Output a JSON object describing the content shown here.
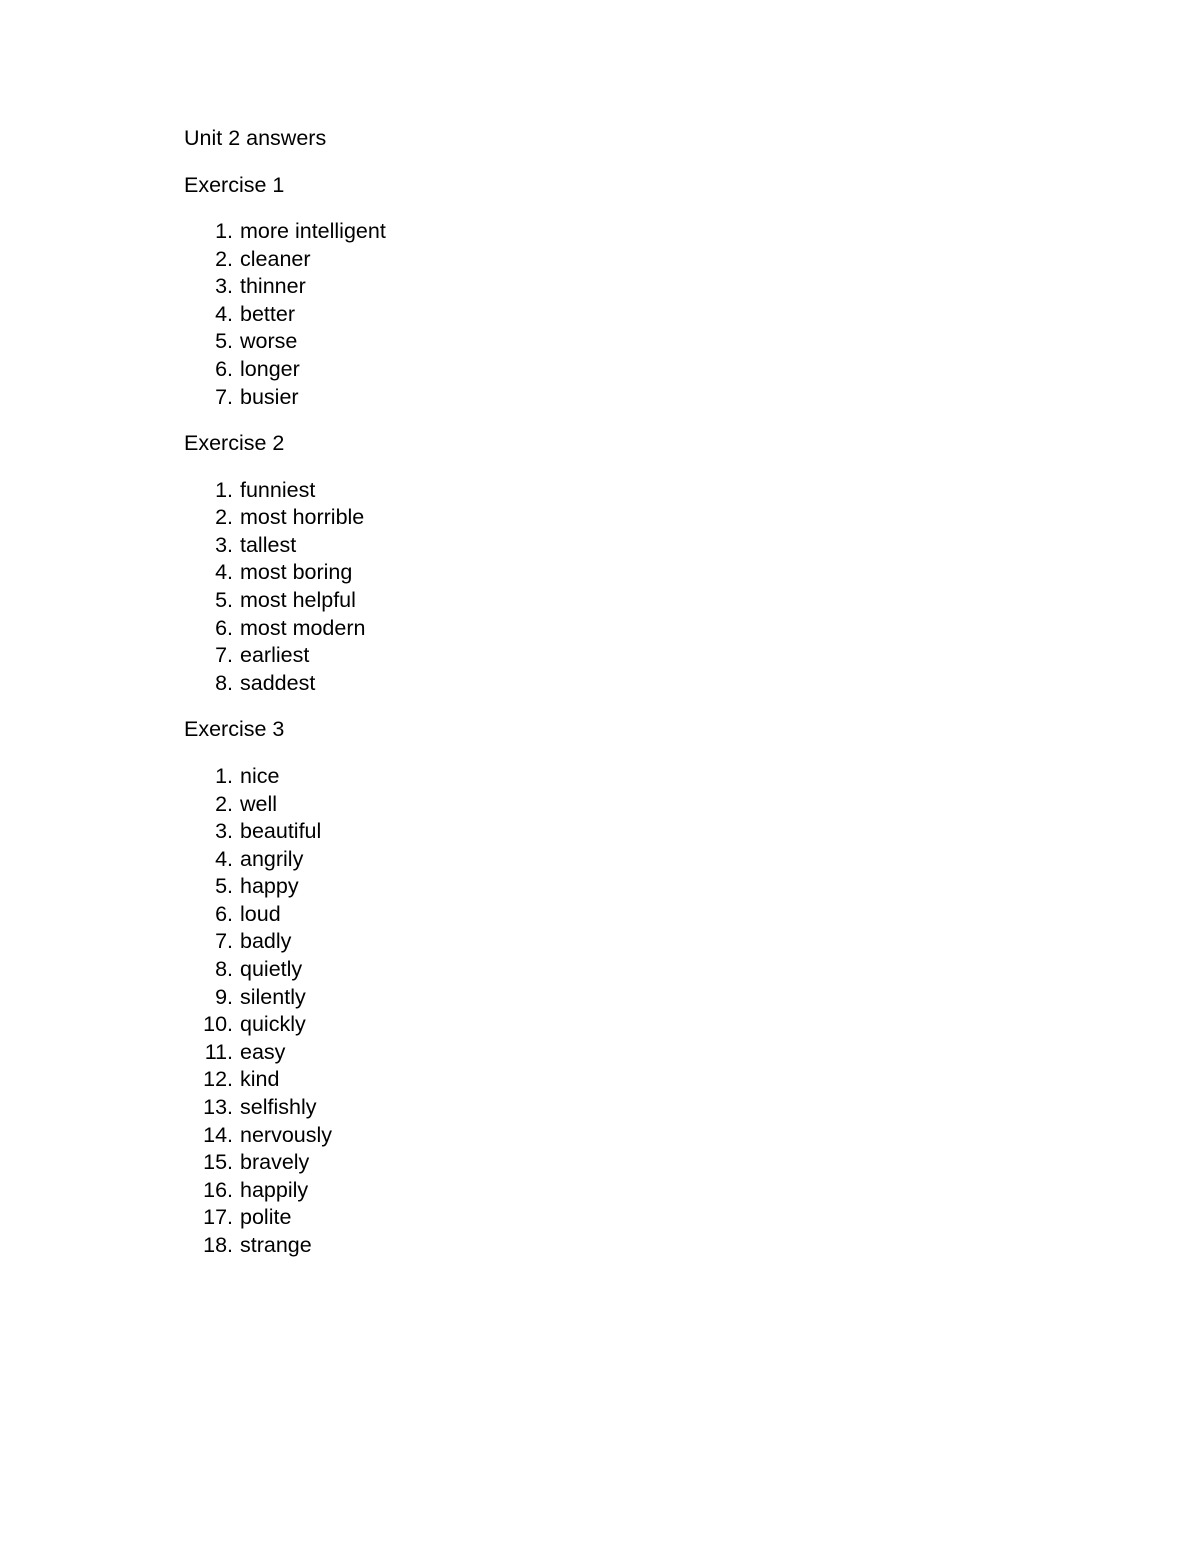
{
  "document": {
    "title": "Unit 2 answers",
    "background_color": "#ffffff",
    "text_color": "#000000",
    "sections": [
      {
        "heading": "Exercise 1",
        "items": [
          "more intelligent",
          "cleaner",
          "thinner",
          "better",
          "worse",
          "longer",
          "busier"
        ]
      },
      {
        "heading": "Exercise 2",
        "items": [
          "funniest",
          "most horrible",
          "tallest",
          "most boring",
          "most helpful",
          "most modern",
          "earliest",
          "saddest"
        ]
      },
      {
        "heading": "Exercise 3",
        "items": [
          "nice",
          "well",
          "beautiful",
          "angrily",
          "happy",
          "loud",
          "badly",
          "quietly",
          "silently",
          "quickly",
          "easy",
          "kind",
          "selfishly",
          "nervously",
          "bravely",
          "happily",
          "polite",
          "strange"
        ]
      }
    ]
  }
}
